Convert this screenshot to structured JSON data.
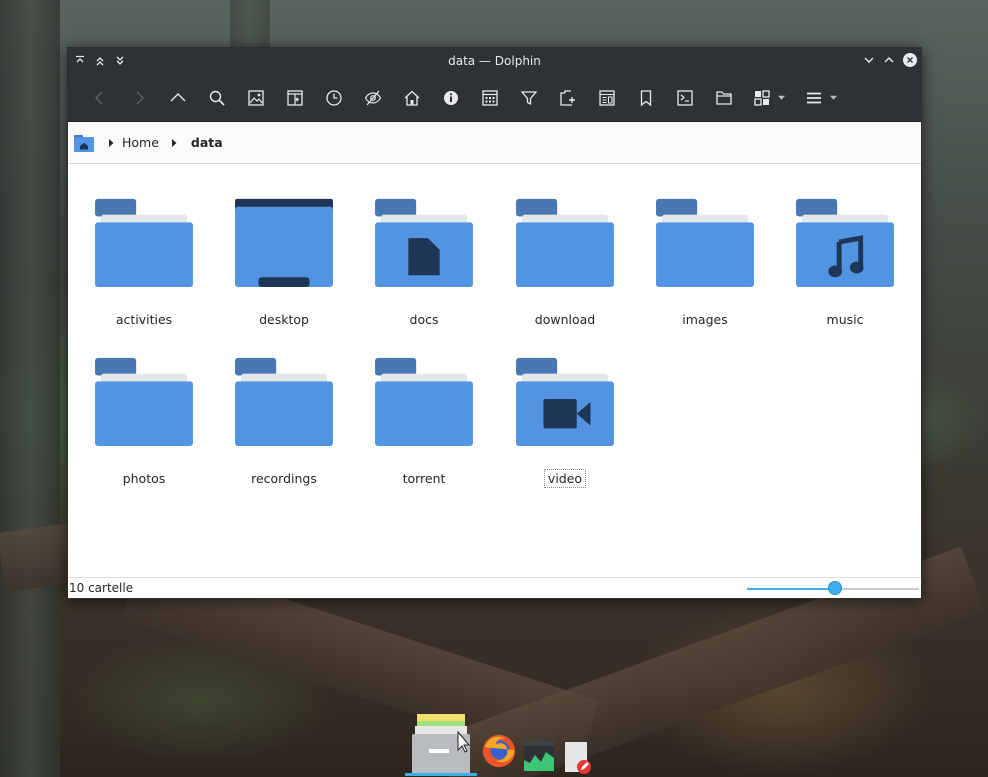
{
  "window": {
    "title": "data — Dolphin"
  },
  "toolbar": {
    "buttons": [
      {
        "icon": "back-icon"
      },
      {
        "icon": "forward-icon"
      },
      {
        "icon": "up-icon"
      },
      {
        "icon": "search-icon"
      },
      {
        "icon": "preview-icon"
      },
      {
        "icon": "split-view-icon"
      },
      {
        "icon": "recent-icon"
      },
      {
        "icon": "hidden-files-icon"
      },
      {
        "icon": "home-icon"
      },
      {
        "icon": "information-icon"
      },
      {
        "icon": "compact-view-icon"
      },
      {
        "icon": "filter-icon"
      },
      {
        "icon": "new-tab-icon"
      },
      {
        "icon": "details-panel-icon"
      },
      {
        "icon": "bookmark-icon"
      },
      {
        "icon": "terminal-icon"
      },
      {
        "icon": "places-icon"
      },
      {
        "icon": "view-mode-icon"
      },
      {
        "icon": "hamburger-menu-icon"
      }
    ]
  },
  "breadcrumb": {
    "items": [
      "Home",
      "data"
    ]
  },
  "files": [
    {
      "name": "activities",
      "type": "folder"
    },
    {
      "name": "desktop",
      "type": "folder-desktop"
    },
    {
      "name": "docs",
      "type": "folder-documents"
    },
    {
      "name": "download",
      "type": "folder"
    },
    {
      "name": "images",
      "type": "folder"
    },
    {
      "name": "music",
      "type": "folder-music"
    },
    {
      "name": "photos",
      "type": "folder"
    },
    {
      "name": "recordings",
      "type": "folder"
    },
    {
      "name": "torrent",
      "type": "folder"
    },
    {
      "name": "video",
      "type": "folder-video"
    }
  ],
  "status": {
    "text": "10 cartelle",
    "zoom_level": 0.51
  },
  "colors": {
    "folder_body": "#5294e2",
    "folder_back": "#4877b1",
    "folder_paper": "#e3e6ea",
    "folder_glyph": "#1f3557",
    "accent": "#3daee9",
    "chrome": "#2e3236"
  },
  "dock": {
    "apps": [
      {
        "icon": "file-manager-icon"
      },
      {
        "icon": "firefox-icon"
      },
      {
        "icon": "system-monitor-icon"
      },
      {
        "icon": "text-editor-icon"
      }
    ]
  }
}
